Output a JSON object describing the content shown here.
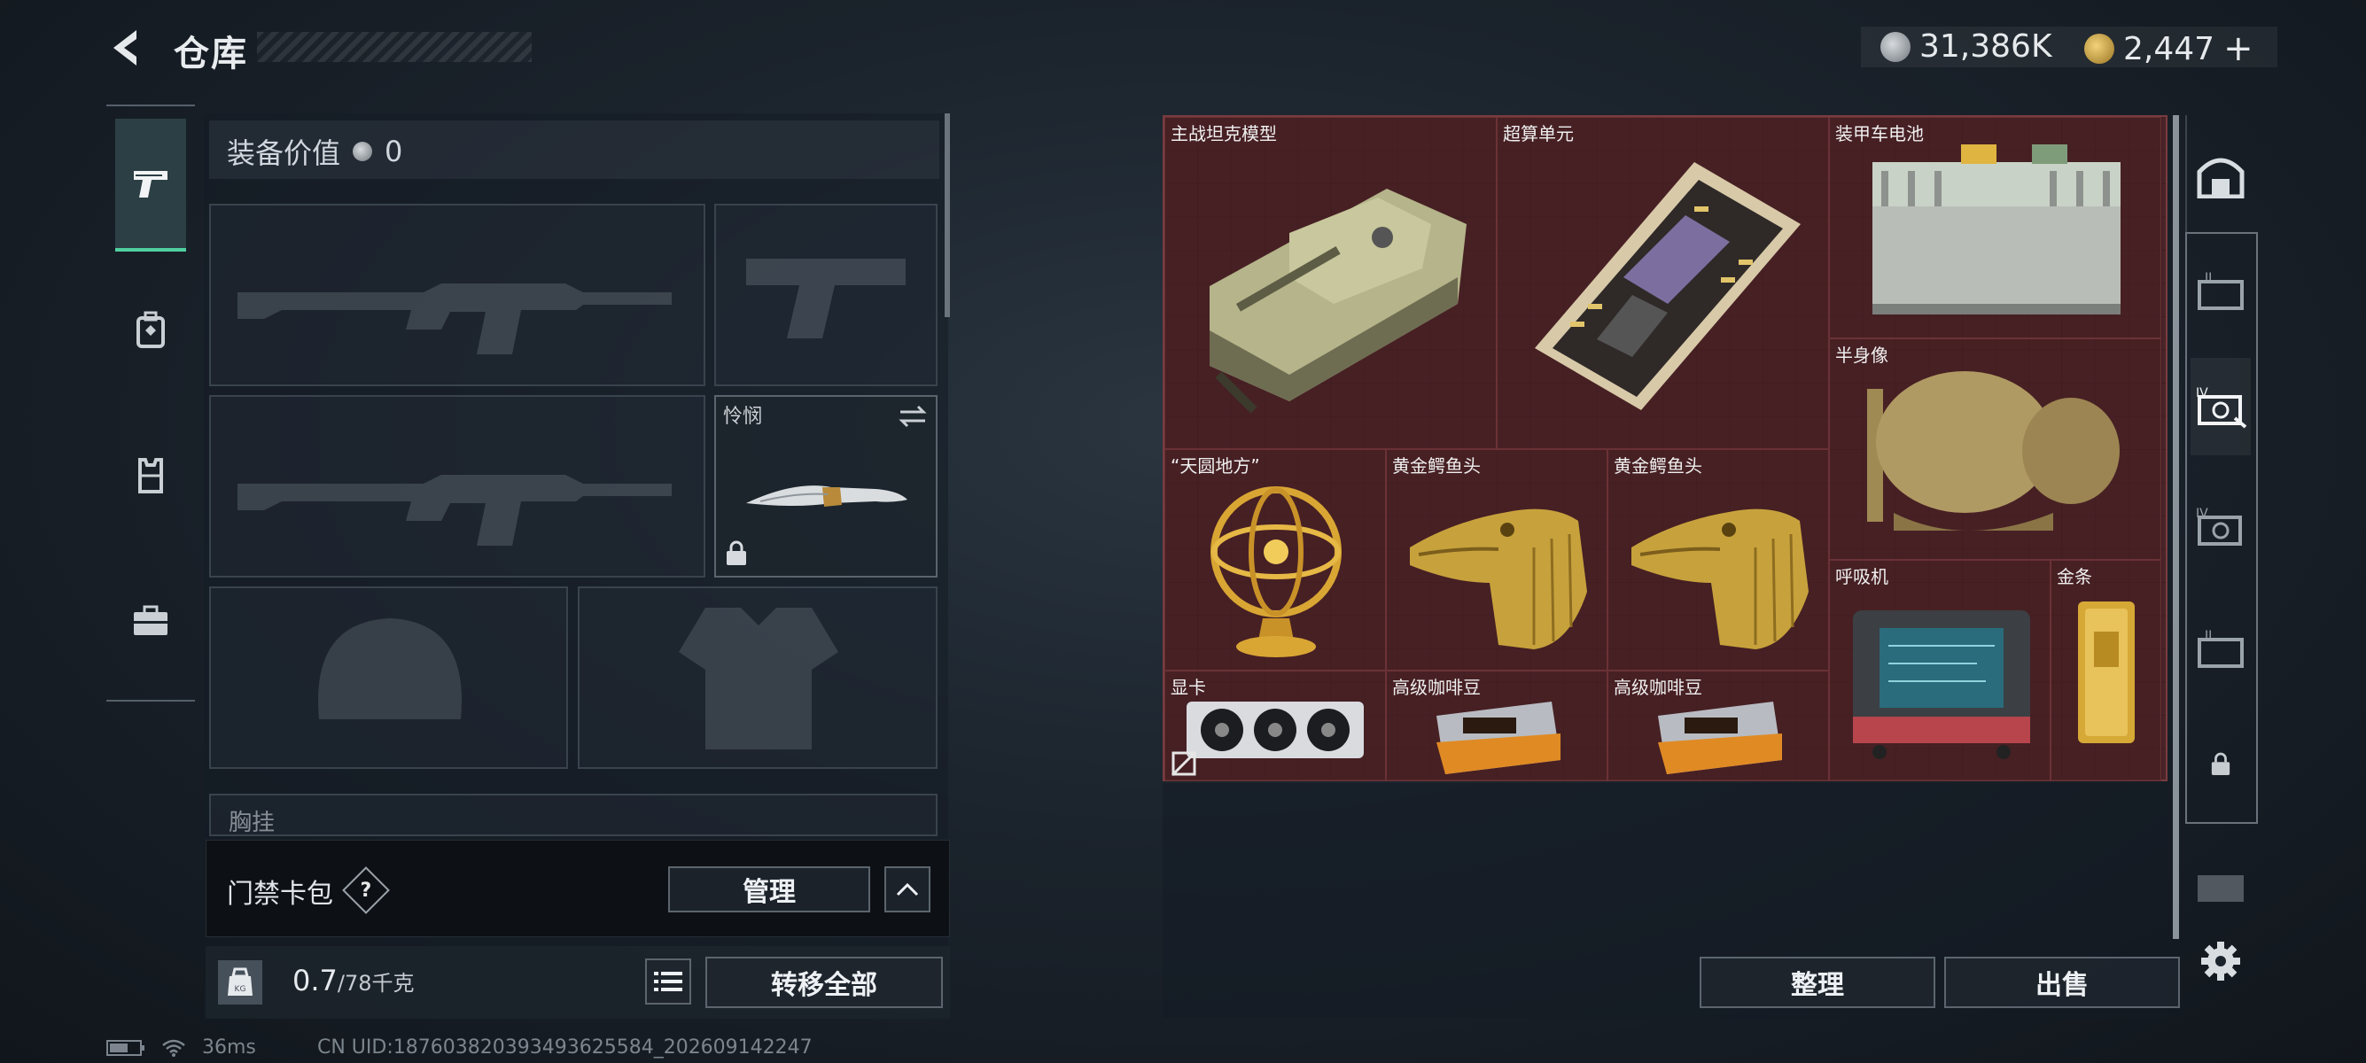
{
  "header": {
    "title": "仓库"
  },
  "currency": {
    "silver": "31,386K",
    "gold": "2,447",
    "plus": "+"
  },
  "left_tabs": [
    {
      "name": "weapon",
      "icon": "pistol-icon",
      "active": true
    },
    {
      "name": "backpack",
      "icon": "backpack-icon",
      "active": false
    },
    {
      "name": "vest",
      "icon": "vest-icon",
      "active": false
    },
    {
      "name": "toolbox",
      "icon": "briefcase-icon",
      "active": false
    }
  ],
  "equipment": {
    "value_label": "装备价值",
    "value": "0",
    "melee_name": "怜悯",
    "chest_label": "胸挂"
  },
  "keycard": {
    "label": "门禁卡包",
    "help": "?",
    "manage": "管理"
  },
  "weight": {
    "current": "0.7",
    "max": "/78千克",
    "transfer_all": "转移全部"
  },
  "stash_items": [
    {
      "name": "主战坦克模型"
    },
    {
      "name": "超算单元"
    },
    {
      "name": "装甲车电池"
    },
    {
      "name": "半身像"
    },
    {
      "name": "“天圆地方”"
    },
    {
      "name": "黄金鳄鱼头"
    },
    {
      "name": "黄金鳄鱼头"
    },
    {
      "name": "呼吸机"
    },
    {
      "name": "金条"
    },
    {
      "name": "显卡"
    },
    {
      "name": "高级咖啡豆"
    },
    {
      "name": "高级咖啡豆"
    }
  ],
  "stash_actions": {
    "sort": "整理",
    "sell": "出售"
  },
  "status": {
    "ping": "36ms",
    "uid": "CN UID:187603820393493625584_202609142247"
  },
  "colors": {
    "accent": "#4fd0a0",
    "stash_bg": "#4a2428"
  }
}
